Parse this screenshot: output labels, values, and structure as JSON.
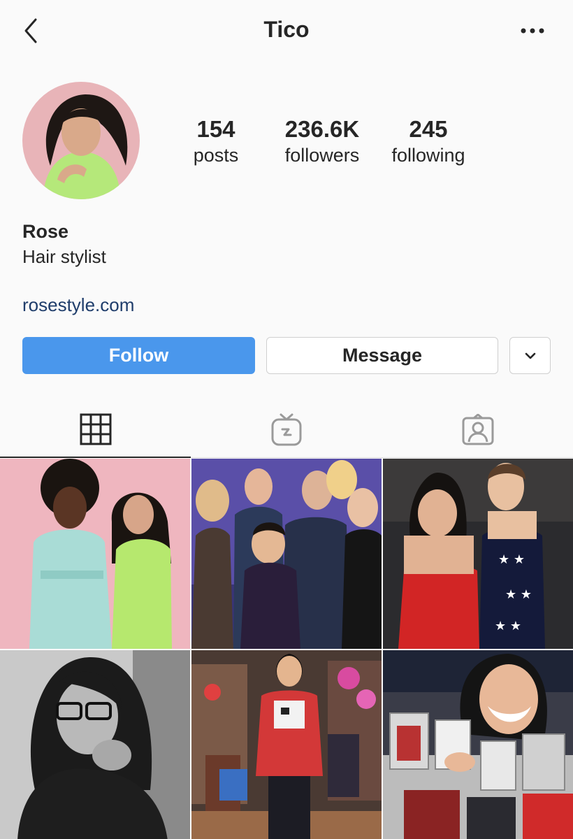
{
  "header": {
    "title": "Tico",
    "back_icon": "chevron-left-icon",
    "more_icon": "ellipsis-icon"
  },
  "profile": {
    "stats": {
      "posts_count": "154",
      "posts_label": "posts",
      "followers_count": "236.6K",
      "followers_label": "followers",
      "following_count": "245",
      "following_label": "following"
    },
    "name": "Rose",
    "bio": "Hair stylist",
    "website": "rosestyle.com"
  },
  "actions": {
    "follow_label": "Follow",
    "message_label": "Message",
    "more_icon": "chevron-down-icon"
  },
  "tabs": [
    {
      "icon": "grid-icon",
      "active": true
    },
    {
      "icon": "igtv-icon",
      "active": false
    },
    {
      "icon": "tagged-icon",
      "active": false
    }
  ],
  "colors": {
    "accent": "#4a97ec",
    "link": "#1f3d6b",
    "text": "#262626",
    "background": "#fafafa"
  }
}
